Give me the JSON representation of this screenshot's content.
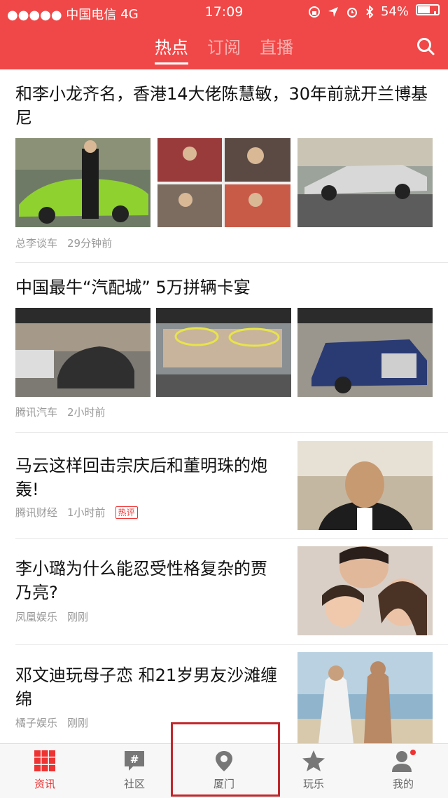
{
  "status_bar": {
    "carrier": "●●●●● 中国电信",
    "network": "4G",
    "time": "17:09",
    "battery": "54%"
  },
  "tabs": [
    {
      "label": "热点",
      "active": true
    },
    {
      "label": "订阅",
      "active": false
    },
    {
      "label": "直播",
      "active": false
    }
  ],
  "articles": [
    {
      "title": "和李小龙齐名，香港14大佬陈慧敏，30年前就开兰博基尼",
      "source": "总李谈车",
      "time": "29分钟前"
    },
    {
      "title": "中国最牛“汽配城” 5万拼辆卡宴",
      "source": "腾讯汽车",
      "time": "2小时前"
    },
    {
      "title": "马云这样回击宗庆后和董明珠的炮轰!",
      "source": "腾讯财经",
      "time": "1小时前",
      "badge": "热评"
    },
    {
      "title": "李小璐为什么能忍受性格复杂的贾乃亮?",
      "source": "凤凰娱乐",
      "time": "刚刚"
    },
    {
      "title": "邓文迪玩母子恋 和21岁男友沙滩缠绵",
      "source": "橘子娱乐",
      "time": "刚刚"
    }
  ],
  "tabbar": [
    {
      "label": "资讯",
      "icon": "grid-icon",
      "active": true
    },
    {
      "label": "社区",
      "icon": "hash-bubble-icon",
      "active": false
    },
    {
      "label": "厦门",
      "icon": "location-pin-icon",
      "active": false
    },
    {
      "label": "玩乐",
      "icon": "star-icon",
      "active": false
    },
    {
      "label": "我的",
      "icon": "person-icon",
      "active": false
    }
  ],
  "colors": {
    "brand": "#f04848",
    "accent": "#e33"
  }
}
